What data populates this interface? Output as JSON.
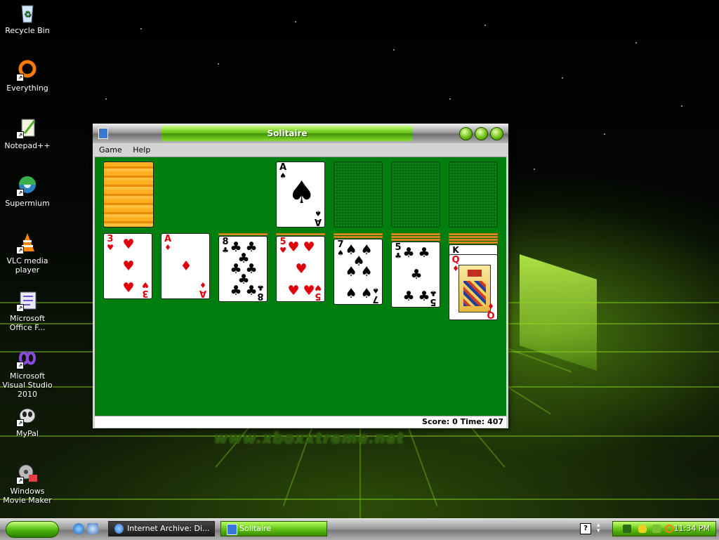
{
  "desktop": {
    "icons": [
      {
        "label": "Recycle Bin",
        "icon": "recycle-bin-icon"
      },
      {
        "label": "Everything",
        "icon": "everything-search-icon"
      },
      {
        "label": "Notepad++",
        "icon": "notepadpp-icon"
      },
      {
        "label": "Supermium",
        "icon": "supermium-browser-icon"
      },
      {
        "label": "VLC media player",
        "icon": "vlc-cone-icon"
      },
      {
        "label": "Microsoft Office F...",
        "icon": "office-icon"
      },
      {
        "label": "Microsoft Visual Studio 2010",
        "icon": "visual-studio-icon"
      },
      {
        "label": "MyPal",
        "icon": "mypal-icon"
      },
      {
        "label": "Windows Movie Maker",
        "icon": "movie-maker-icon"
      }
    ],
    "watermark": "www.xboxxtreme.net"
  },
  "window": {
    "title": "Solitaire",
    "menu": [
      "Game",
      "Help"
    ],
    "status": "Score: 0 Time: 407",
    "foundation_top": {
      "rank": "A",
      "suit": "♠"
    },
    "tableau": [
      {
        "rank": "3",
        "suit": "♥"
      },
      {
        "rank": "A",
        "suit": "♦"
      },
      {
        "rank": "8",
        "suit": "♣"
      },
      {
        "rank": "5",
        "suit": "♥"
      },
      {
        "rank": "7",
        "suit": "♠"
      },
      {
        "rank": "5",
        "suit": "♣"
      },
      {
        "rank": "Q",
        "suit": "♦",
        "under_rank": "K"
      }
    ]
  },
  "taskbar": {
    "tasks": [
      "Internet Archive: Di...",
      "Solitaire"
    ],
    "clock": "11:34 PM",
    "help_glyph": "?"
  },
  "colors": {
    "felt": "#007f0e",
    "accent_green": "#5fbe10",
    "card_red": "#e0000c"
  }
}
